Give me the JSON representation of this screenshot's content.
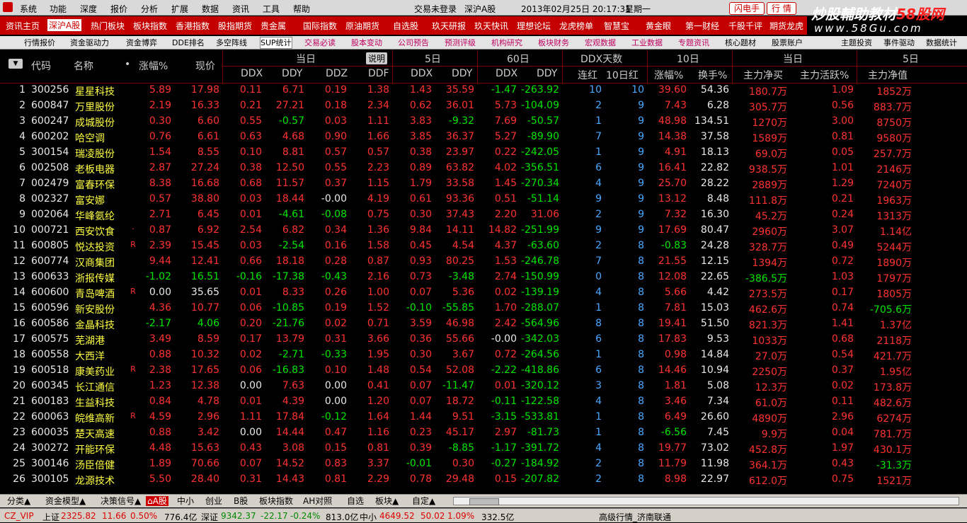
{
  "menu": {
    "items": [
      "系统",
      "功能",
      "深度",
      "报价",
      "分析",
      "扩展",
      "数据",
      "资讯",
      "工具",
      "帮助"
    ],
    "status": "交易未登录",
    "market": "深沪A股",
    "datetime": "2013年02月25日  20:17:31",
    "weekday": "星期一",
    "btn_flash": "闪电手",
    "btn_quote": "行  情"
  },
  "brand": {
    "line1_a": "炒股輔助教材",
    "line1_b": "58股网",
    "line2": "www.58Gu.com"
  },
  "redbar": [
    "资讯主页",
    "深沪A股",
    "热门板块",
    "板块指数",
    "香港指数",
    "股指期货",
    "贵金属",
    "国际指数",
    "原油期货",
    "自选股",
    "玖天研报",
    "玖天快讯",
    "理想论坛",
    "龙虎榜单",
    "智慧宝",
    "黄金眼",
    "第一财经",
    "千股千评",
    "期货龙虎"
  ],
  "tabs": [
    "行情报价",
    "资金驱动力",
    "资金博弈",
    "DDE排名",
    "多空阵线",
    "SUP统计",
    "交易必读",
    "股本变动",
    "公司预告",
    "预测评级",
    "机构研究",
    "板块财务",
    "宏观数据",
    "工业数据",
    "专题资讯",
    "核心题材",
    "股票账户",
    "主题投资",
    "事件驱动",
    "数据统计"
  ],
  "header": {
    "code": "代码",
    "name": "名称",
    "dot": "•",
    "zf": "涨幅%",
    "price": "现价",
    "g_today": "当日",
    "shuoming": "说明",
    "g_5d": "5日",
    "g_60d": "60日",
    "g_ddxdays": "DDX天数",
    "g_10d": "10日",
    "g_today2": "当日",
    "g_5d2": "5日",
    "ddx": "DDX",
    "ddy": "DDY",
    "ddz": "DDZ",
    "ddf": "DDF",
    "ddx5": "DDX",
    "ddy5": "DDY",
    "ddx60": "DDX",
    "ddy60": "DDY",
    "lianhong": "连红",
    "hong10": "10日红",
    "zf10": "涨幅%",
    "hs10": "换手%",
    "zljm": "主力净买",
    "zlhy": "主力活跃%",
    "zljm5": "主力净值"
  },
  "colors": {
    "up": "#ff3232",
    "down": "#00e600",
    "flat": "#e8e8e8",
    "days": "#4aa8ff",
    "code": "#e8e8e8",
    "name": "#ffff44"
  },
  "rows": [
    [
      "1",
      "300256",
      "星星科技",
      "",
      "5.89",
      "17.98",
      "0.11",
      "6.71",
      "0.19",
      "1.38",
      "1.43",
      "35.59",
      "-1.47",
      "-263.92",
      "10",
      "10",
      "39.60",
      "54.36",
      "180.7万",
      "1.09",
      "1852万"
    ],
    [
      "2",
      "600847",
      "万里股份",
      "",
      "2.19",
      "16.33",
      "0.21",
      "27.21",
      "0.18",
      "2.34",
      "0.62",
      "36.01",
      "5.73",
      "-104.09",
      "2",
      "9",
      "7.43",
      "6.28",
      "305.7万",
      "0.56",
      "883.7万"
    ],
    [
      "3",
      "600247",
      "成城股份",
      "",
      "0.30",
      "6.60",
      "0.55",
      "-0.57",
      "0.03",
      "1.11",
      "3.83",
      "-9.32",
      "7.69",
      "-50.57",
      "1",
      "9",
      "48.98",
      "134.51",
      "1270万",
      "3.00",
      "8750万"
    ],
    [
      "4",
      "600202",
      "哈空调",
      "",
      "0.76",
      "6.61",
      "0.63",
      "4.68",
      "0.90",
      "1.66",
      "3.85",
      "36.37",
      "5.27",
      "-89.90",
      "7",
      "9",
      "14.38",
      "37.58",
      "1589万",
      "0.81",
      "9580万"
    ],
    [
      "5",
      "300154",
      "瑞凌股份",
      "",
      "1.54",
      "8.55",
      "0.10",
      "8.81",
      "0.57",
      "0.57",
      "0.38",
      "23.97",
      "0.22",
      "-242.05",
      "1",
      "9",
      "4.91",
      "18.13",
      "69.0万",
      "0.05",
      "257.7万"
    ],
    [
      "6",
      "002508",
      "老板电器",
      "",
      "2.87",
      "27.24",
      "0.38",
      "12.50",
      "0.55",
      "2.23",
      "0.89",
      "63.82",
      "4.02",
      "-356.51",
      "6",
      "9",
      "16.41",
      "22.82",
      "938.5万",
      "1.01",
      "2146万"
    ],
    [
      "7",
      "002479",
      "富春环保",
      "",
      "8.38",
      "16.68",
      "0.68",
      "11.57",
      "0.37",
      "1.15",
      "1.79",
      "33.58",
      "1.45",
      "-270.34",
      "4",
      "9",
      "25.70",
      "28.22",
      "2889万",
      "1.29",
      "7240万"
    ],
    [
      "8",
      "002327",
      "富安娜",
      "",
      "0.57",
      "38.80",
      "0.03",
      "18.44",
      "-0.00",
      "4.19",
      "0.61",
      "93.36",
      "0.51",
      "-51.14",
      "9",
      "9",
      "13.12",
      "8.48",
      "111.8万",
      "0.21",
      "1963万"
    ],
    [
      "9",
      "002064",
      "华峰氨纶",
      "",
      "2.71",
      "6.45",
      "0.01",
      "-4.61",
      "-0.08",
      "0.75",
      "0.30",
      "37.43",
      "2.20",
      "31.06",
      "2",
      "9",
      "7.32",
      "16.30",
      "45.2万",
      "0.24",
      "1313万"
    ],
    [
      "10",
      "000721",
      "西安饮食",
      "·",
      "0.87",
      "6.92",
      "2.54",
      "6.82",
      "0.34",
      "1.36",
      "9.84",
      "14.11",
      "14.82",
      "-251.99",
      "9",
      "9",
      "17.69",
      "80.47",
      "2960万",
      "3.07",
      "1.14亿"
    ],
    [
      "11",
      "600805",
      "悦达投资",
      "R",
      "2.39",
      "15.45",
      "0.03",
      "-2.54",
      "0.16",
      "1.58",
      "0.45",
      "4.54",
      "4.37",
      "-63.60",
      "2",
      "8",
      "-0.83",
      "24.28",
      "328.7万",
      "0.49",
      "5244万"
    ],
    [
      "12",
      "600774",
      "汉商集团",
      "",
      "9.44",
      "12.41",
      "0.66",
      "18.18",
      "0.28",
      "0.87",
      "0.93",
      "80.25",
      "1.53",
      "-246.78",
      "7",
      "8",
      "21.55",
      "12.15",
      "1394万",
      "0.72",
      "1890万"
    ],
    [
      "13",
      "600633",
      "浙报传媒",
      "",
      "-1.02",
      "16.51",
      "-0.16",
      "-17.38",
      "-0.43",
      "2.16",
      "0.73",
      "-3.48",
      "2.74",
      "-150.99",
      "0",
      "8",
      "12.08",
      "22.65",
      "-386.5万",
      "1.03",
      "1797万"
    ],
    [
      "14",
      "600600",
      "青岛啤酒",
      "R",
      "0.00",
      "35.65",
      "0.01",
      "8.33",
      "0.26",
      "1.00",
      "0.07",
      "5.36",
      "0.02",
      "-139.19",
      "4",
      "8",
      "5.66",
      "4.42",
      "273.5万",
      "0.17",
      "1805万"
    ],
    [
      "15",
      "600596",
      "新安股份",
      "",
      "4.36",
      "10.77",
      "0.06",
      "-10.85",
      "0.19",
      "1.52",
      "-0.10",
      "-55.85",
      "1.70",
      "-288.07",
      "1",
      "8",
      "7.81",
      "15.03",
      "462.6万",
      "0.74",
      "-705.6万"
    ],
    [
      "16",
      "600586",
      "金晶科技",
      "",
      "-2.17",
      "4.06",
      "0.20",
      "-21.76",
      "0.02",
      "0.71",
      "3.59",
      "46.98",
      "2.42",
      "-564.96",
      "8",
      "8",
      "19.41",
      "51.50",
      "821.3万",
      "1.41",
      "1.37亿"
    ],
    [
      "17",
      "600575",
      "芜湖港",
      "",
      "3.49",
      "8.59",
      "0.17",
      "13.79",
      "0.31",
      "3.66",
      "0.36",
      "55.66",
      "-0.00",
      "-342.03",
      "6",
      "8",
      "17.83",
      "9.53",
      "1033万",
      "0.68",
      "2118万"
    ],
    [
      "18",
      "600558",
      "大西洋",
      "",
      "0.88",
      "10.32",
      "0.02",
      "-2.71",
      "-0.33",
      "1.95",
      "0.30",
      "3.67",
      "0.72",
      "-264.56",
      "1",
      "8",
      "0.98",
      "14.84",
      "27.0万",
      "0.54",
      "421.7万"
    ],
    [
      "19",
      "600518",
      "康美药业",
      "R",
      "2.38",
      "17.65",
      "0.06",
      "-16.83",
      "0.10",
      "1.48",
      "0.54",
      "52.08",
      "-2.22",
      "-418.86",
      "6",
      "8",
      "14.46",
      "10.94",
      "2250万",
      "0.37",
      "1.95亿"
    ],
    [
      "20",
      "600345",
      "长江通信",
      "",
      "1.23",
      "12.38",
      "0.00",
      "7.63",
      "0.00",
      "0.41",
      "0.07",
      "-11.47",
      "0.01",
      "-320.12",
      "3",
      "8",
      "1.81",
      "5.08",
      "12.3万",
      "0.02",
      "173.8万"
    ],
    [
      "21",
      "600183",
      "生益科技",
      "",
      "0.84",
      "4.78",
      "0.01",
      "4.39",
      "0.00",
      "1.20",
      "0.07",
      "18.72",
      "-0.11",
      "-122.58",
      "4",
      "8",
      "3.46",
      "7.34",
      "61.0万",
      "0.11",
      "482.6万"
    ],
    [
      "22",
      "600063",
      "皖维高新",
      "R",
      "4.59",
      "2.96",
      "1.11",
      "17.84",
      "-0.12",
      "1.64",
      "1.44",
      "9.51",
      "-3.15",
      "-533.81",
      "1",
      "8",
      "6.49",
      "26.60",
      "4890万",
      "2.96",
      "6274万"
    ],
    [
      "23",
      "600035",
      "楚天高速",
      "",
      "0.88",
      "3.42",
      "0.00",
      "14.44",
      "0.47",
      "1.16",
      "0.23",
      "45.17",
      "2.97",
      "-81.73",
      "1",
      "8",
      "-6.56",
      "7.45",
      "9.9万",
      "0.04",
      "781.7万"
    ],
    [
      "24",
      "300272",
      "开能环保",
      "",
      "4.48",
      "15.63",
      "0.43",
      "3.08",
      "0.15",
      "0.81",
      "0.39",
      "-8.85",
      "-1.17",
      "-391.72",
      "4",
      "8",
      "19.77",
      "73.02",
      "452.8万",
      "1.97",
      "430.1万"
    ],
    [
      "25",
      "300146",
      "汤臣倍健",
      "",
      "1.89",
      "70.66",
      "0.07",
      "14.52",
      "0.83",
      "3.37",
      "-0.01",
      "0.30",
      "-0.27",
      "-184.92",
      "2",
      "8",
      "11.79",
      "11.98",
      "364.1万",
      "0.43",
      "-31.3万"
    ],
    [
      "26",
      "300105",
      "龙源技术",
      "",
      "5.50",
      "28.40",
      "0.31",
      "14.43",
      "0.81",
      "2.29",
      "0.78",
      "29.48",
      "0.15",
      "-207.82",
      "2",
      "8",
      "8.98",
      "22.97",
      "612.0万",
      "0.75",
      "1521万"
    ]
  ],
  "bottom_tabs": [
    "分类▲",
    "资金模型▲",
    "决策信号▲",
    "A股",
    "中小",
    "创业",
    "B股",
    "板块指数",
    "AH对照",
    "自选",
    "板块▲",
    "自定▲"
  ],
  "statusbar": {
    "vip": "CZ_VIP",
    "sh_label": "上证",
    "sh_val": "2325.82",
    "sh_chg": "11.66",
    "sh_pct": "0.50%",
    "sh_amt": "776.4亿",
    "sz_label": "深证",
    "sz_val": "9342.37",
    "sz_chg": "-22.17",
    "sz_pct": "-0.24%",
    "sz_amt": "813.0亿",
    "zx_label": "中小",
    "zx_val": "4649.52",
    "zx_chg": "50.02",
    "zx_pct": "1.09%",
    "zx_amt": "332.5亿",
    "server": "高级行情_济南联通"
  }
}
